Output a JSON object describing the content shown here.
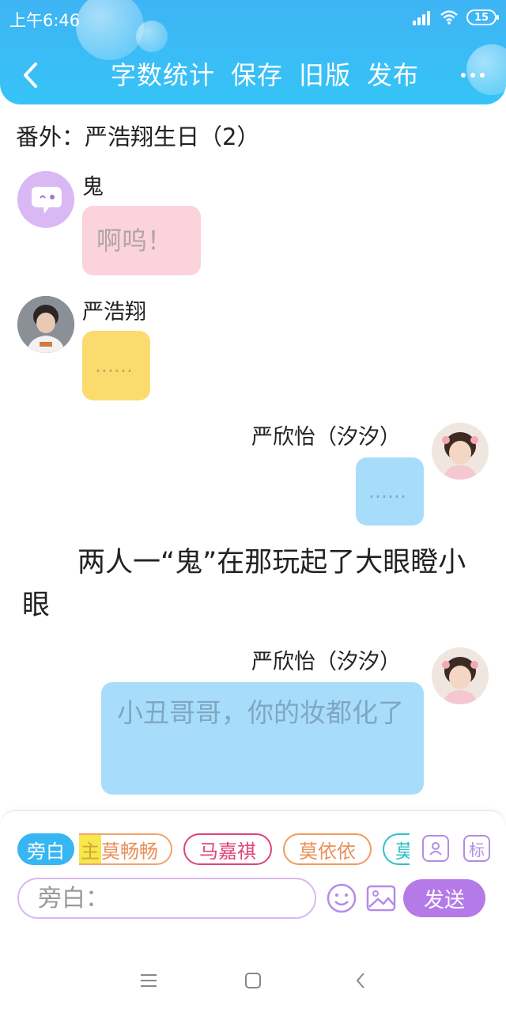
{
  "status_bar": {
    "time": "上午6:46",
    "battery": "15",
    "signal_icon": "signal-icon",
    "wifi_icon": "wifi-icon"
  },
  "toolbar": {
    "back_icon": "back-icon",
    "items": [
      "字数统计",
      "保存",
      "旧版",
      "发布"
    ],
    "more_icon": "more-icon"
  },
  "chapter": {
    "title": "番外：严浩翔生日（2）"
  },
  "messages": [
    {
      "sender": "鬼",
      "text": "啊呜！",
      "side": "left",
      "bubble_color": "#fbd3dd",
      "text_color": "#b0a4a9"
    },
    {
      "sender": "严浩翔",
      "text": "……",
      "side": "left",
      "bubble_color": "#fbdb6e",
      "text_color": "#c7a85a"
    },
    {
      "sender": "严欣怡（汐汐）",
      "text": "……",
      "side": "right",
      "bubble_color": "#a8dcfb",
      "text_color": "#7fa9c2"
    },
    {
      "sender": "严欣怡（汐汐）",
      "text": "小丑哥哥，你的妆都化了",
      "side": "right",
      "bubble_color": "#a8dcfb",
      "text_color": "#7ea7c0"
    }
  ],
  "narration": "两人一“鬼”在那玩起了大眼瞪小眼",
  "input_panel": {
    "roles": [
      {
        "label": "旁白",
        "selected": true,
        "color": "#36b6f2"
      },
      {
        "label": "莫畅畅",
        "selected": false,
        "color": "#f2a36b",
        "prefix": "主"
      },
      {
        "label": "马嘉祺",
        "selected": false,
        "color": "#e0427a"
      },
      {
        "label": "莫依依",
        "selected": false,
        "color": "#f29a5c"
      },
      {
        "label": "莫",
        "selected": false,
        "color": "#2fc1c9"
      }
    ],
    "contact_icon": "contact-icon",
    "tag_label": "标",
    "input_placeholder": "旁白：",
    "emoji_icon": "emoji-icon",
    "image_icon": "image-icon",
    "send_label": "发送"
  },
  "nav_bar": {
    "menu_icon": "menu-icon",
    "home_icon": "home-icon",
    "back_icon": "nav-back-icon"
  }
}
